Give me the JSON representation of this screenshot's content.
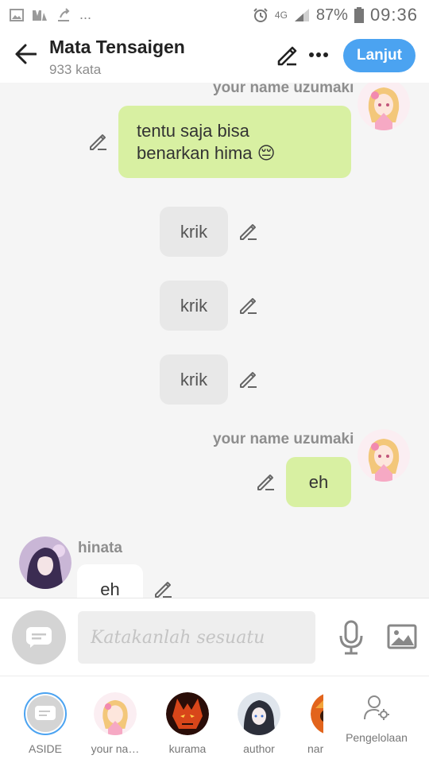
{
  "status_bar": {
    "ellipsis": "...",
    "network": "4G",
    "battery": "87%",
    "time": "09:36"
  },
  "header": {
    "title": "Mata Tensaigen",
    "word_count": "933 kata",
    "next_label": "Lanjut"
  },
  "messages": [
    {
      "sender": "your name uzumaki",
      "text_line1": "tentu saja bisa",
      "text_line2": "benarkan hima 😔"
    },
    {
      "text": "krik"
    },
    {
      "text": "krik"
    },
    {
      "text": "krik"
    },
    {
      "sender": "your name uzumaki",
      "text": "eh"
    },
    {
      "sender": "hinata",
      "text": "eh"
    }
  ],
  "input": {
    "placeholder": "Katakanlah sesuatu"
  },
  "characters": [
    {
      "label": "ASIDE"
    },
    {
      "label": "your na…"
    },
    {
      "label": "kurama"
    },
    {
      "label": "author"
    },
    {
      "label": "nar"
    }
  ],
  "manage_label": "Pengelolaan",
  "colors": {
    "accent": "#4ba3f1",
    "user_bubble": "#d8f0a2",
    "narration_bubble": "#e8e8e8"
  }
}
